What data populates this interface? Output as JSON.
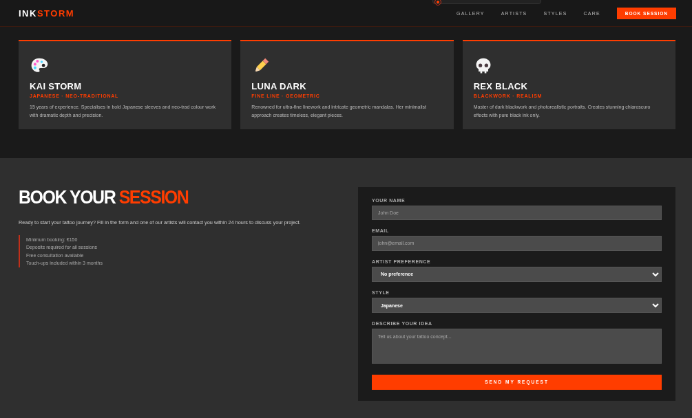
{
  "brand": {
    "first": "INK",
    "second": "STORM"
  },
  "nav": [
    {
      "label": "GALLERY"
    },
    {
      "label": "ARTISTS"
    },
    {
      "label": "STYLES"
    },
    {
      "label": "CARE"
    }
  ],
  "cta": "BOOK SESSION",
  "artists": [
    {
      "kind": "palette",
      "name": "KAI STORM",
      "styles": "JAPANESE · NEO-TRADITIONAL",
      "bio": "15 years of experience. Specialises in bold Japanese sleeves and neo-trad colour work with dramatic depth and precision."
    },
    {
      "kind": "pencil",
      "name": "LUNA DARK",
      "styles": "FINE LINE · GEOMETRIC",
      "bio": "Renowned for ultra-fine linework and intricate geometric mandalas. Her minimalist approach creates timeless, elegant pieces."
    },
    {
      "kind": "skull",
      "name": "REX BLACK",
      "styles": "BLACKWORK · REALISM",
      "bio": "Master of dark blackwork and photorealistic portraits. Creates stunning chiaroscuro effects with pure black ink only."
    }
  ],
  "booking": {
    "title_first": "BOOK YOUR",
    "title_second": "SESSION",
    "intro": "Ready to start your tattoo journey? Fill in the form and one of our artists will contact you within 24 hours to discuss your project.",
    "notes": [
      "Minimum booking: €150",
      "Deposits required for all sessions",
      "Free consultation available",
      "Touch-ups included within 3 months"
    ]
  },
  "form": {
    "fields": [
      {
        "kind": "input",
        "label": "YOUR NAME",
        "placeholder": "John Doe"
      },
      {
        "kind": "input",
        "label": "EMAIL",
        "placeholder": "john@email.com"
      },
      {
        "kind": "select",
        "label": "ARTIST PREFERENCE",
        "value": "No preference"
      },
      {
        "kind": "select",
        "label": "STYLE",
        "value": "Japanese"
      },
      {
        "kind": "textarea",
        "label": "DESCRIBE YOUR IDEA",
        "placeholder": "Tell us about your tattoo concept..."
      }
    ],
    "submit": "SEND MY REQUEST"
  }
}
